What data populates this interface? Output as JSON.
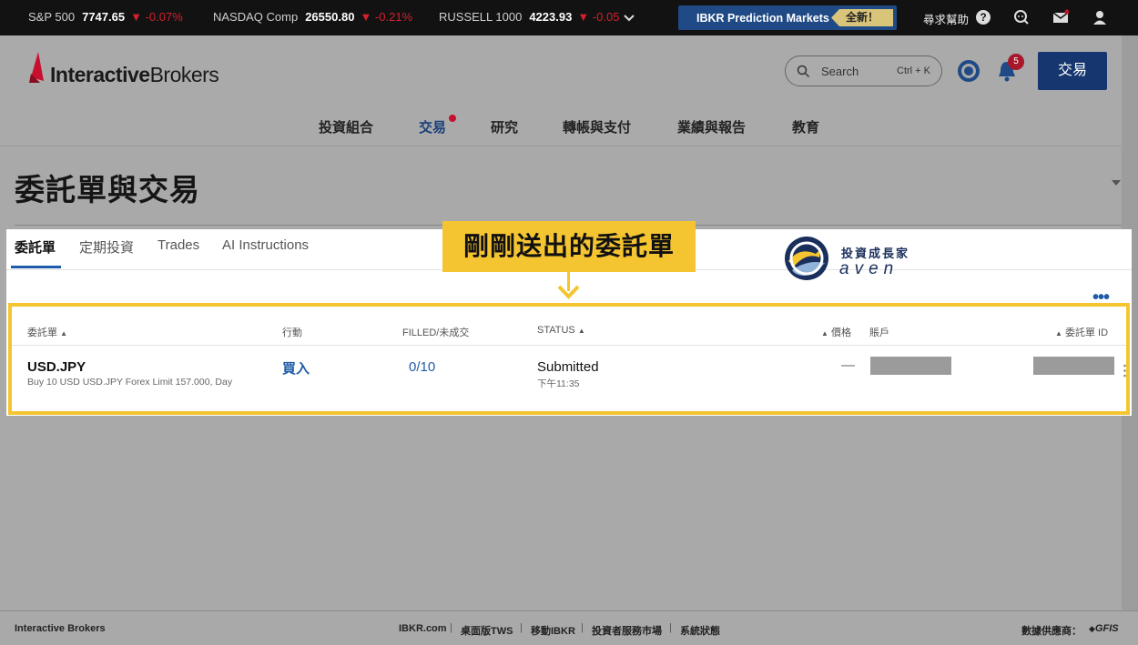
{
  "ticker": [
    {
      "name": "S&P 500",
      "value": "7747.65",
      "change": "-0.07%"
    },
    {
      "name": "NASDAQ Comp",
      "value": "26550.80",
      "change": "-0.21%"
    },
    {
      "name": "RUSSELL 1000",
      "value": "4223.93",
      "change": "-0.05"
    }
  ],
  "promo": {
    "label": "IBKR Prediction Markets",
    "badge": "全新！"
  },
  "topbar": {
    "help": "尋求幫助"
  },
  "header": {
    "logo_bold": "Interactive",
    "logo_rest": "Brokers",
    "search_placeholder": "Search",
    "search_shortcut": "Ctrl + K",
    "notif_count": "5",
    "trade_button": "交易"
  },
  "nav": [
    "投資組合",
    "交易",
    "研究",
    "轉帳與支付",
    "業績與報告",
    "教育"
  ],
  "page": {
    "title": "委託單與交易"
  },
  "tabs": [
    "委託單",
    "定期投資",
    "Trades",
    "AI Instructions"
  ],
  "callout": "剛剛送出的委託單",
  "watermark": {
    "chinese": "投資成長家",
    "english": "aven"
  },
  "table": {
    "headers": {
      "order": "委託單",
      "action": "行動",
      "filled": "FILLED/未成交",
      "status": "STATUS",
      "price": "價格",
      "account": "賬戶",
      "order_id": "委託單 ID"
    },
    "rows": [
      {
        "symbol": "USD.JPY",
        "description": "Buy 10 USD USD.JPY Forex Limit 157.000, Day",
        "action": "買入",
        "filled": "0/10",
        "status": "Submitted",
        "time": "下午11:35",
        "price": "—"
      }
    ]
  },
  "footer": {
    "brand": "Interactive Brokers",
    "links": [
      "IBKR.com",
      "桌面版TWS",
      "移動IBKR",
      "投資者服務市場",
      "系統狀態"
    ],
    "data_provider": "數據供應商：",
    "provider_name": "GFIS"
  },
  "colors": {
    "accent": "#1f5ba8",
    "highlight": "#f5c531",
    "trade_button": "#15366e",
    "down": "#d4212d"
  }
}
